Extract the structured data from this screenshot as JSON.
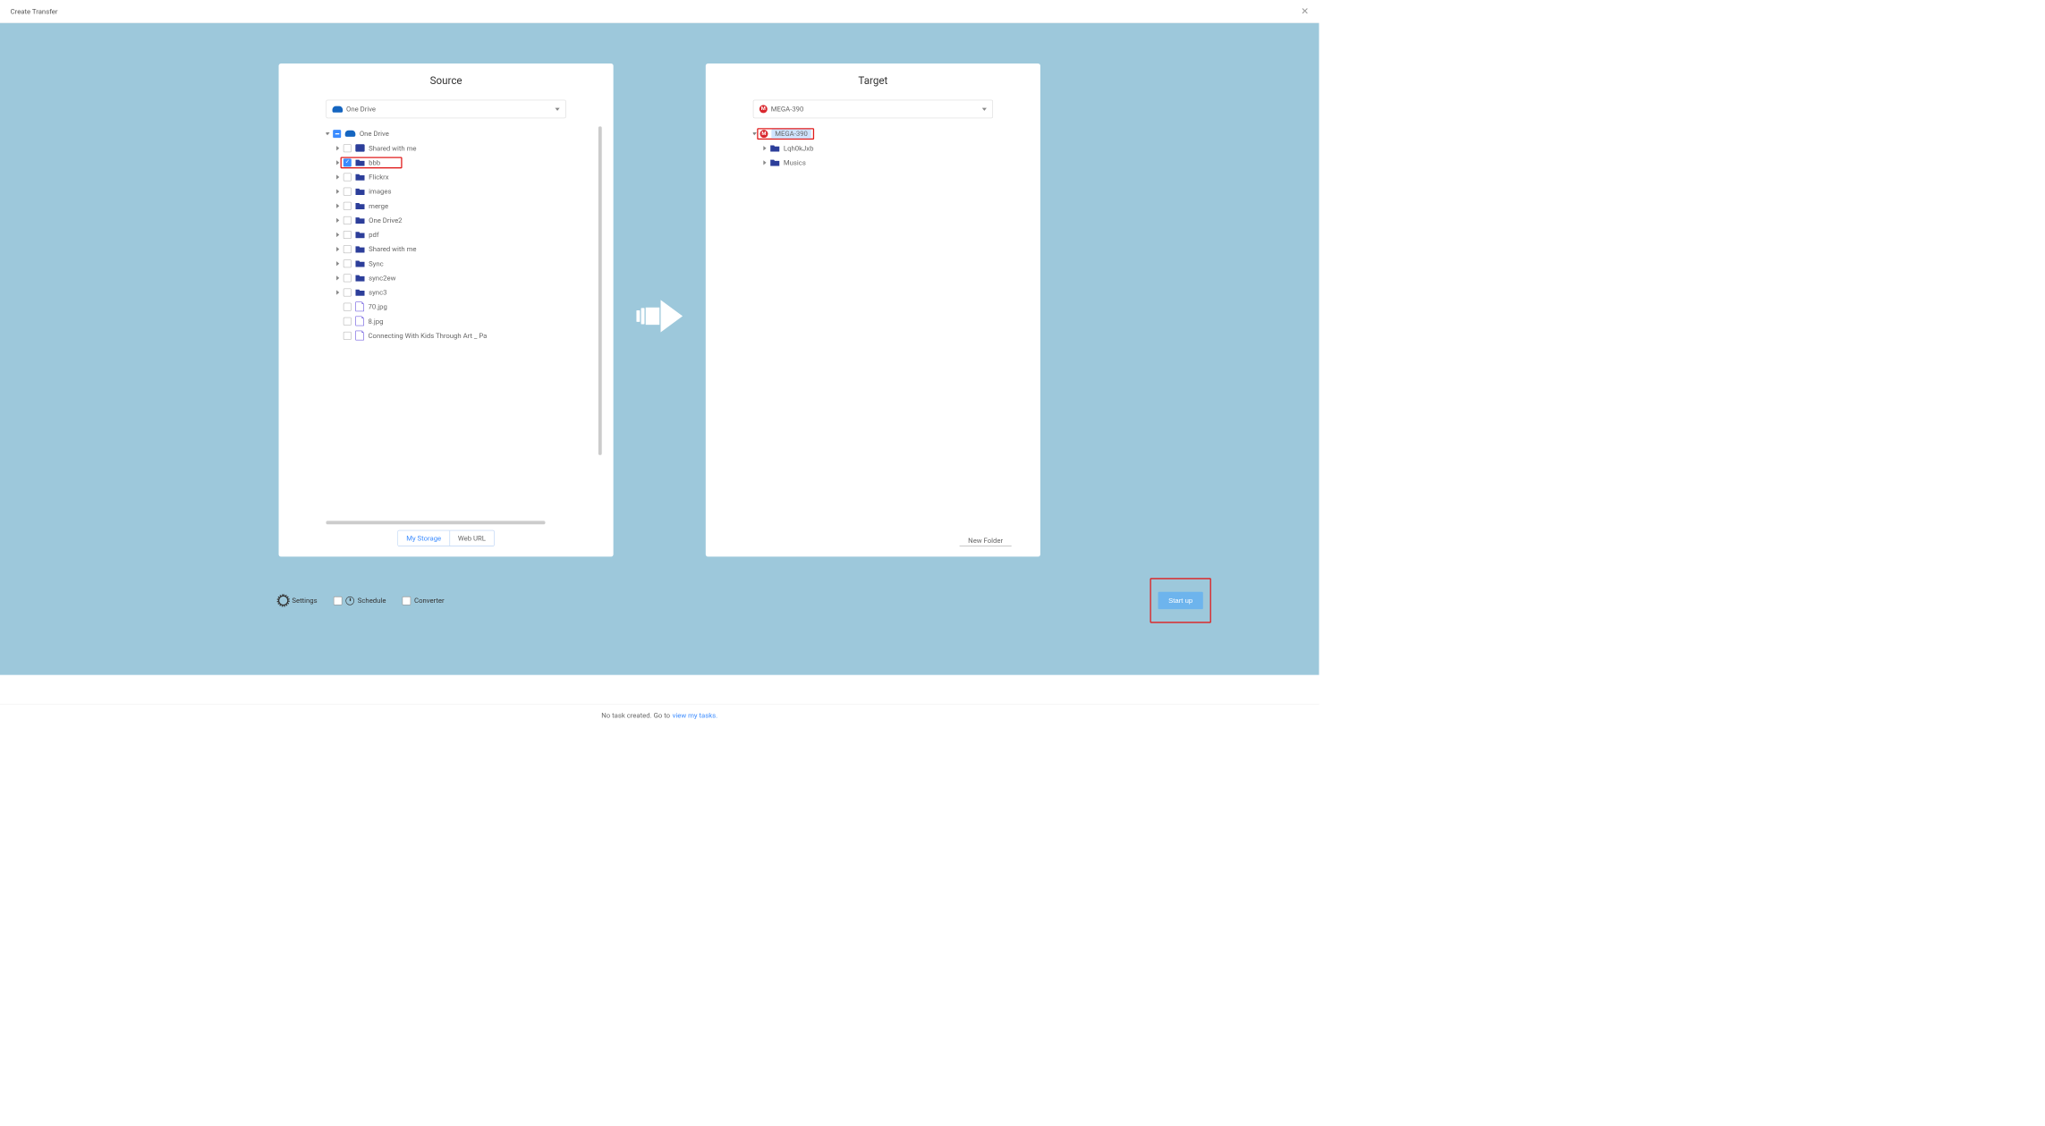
{
  "header": {
    "title": "Create Transfer"
  },
  "source": {
    "title": "Source",
    "selected_cloud": "One Drive",
    "root": "One Drive",
    "folders": [
      {
        "name": "Shared with me",
        "kind": "shared"
      },
      {
        "name": "bbb",
        "kind": "folder",
        "checked": true,
        "hl": true
      },
      {
        "name": "Flickrx",
        "kind": "folder"
      },
      {
        "name": "images",
        "kind": "folder"
      },
      {
        "name": "merge",
        "kind": "folder"
      },
      {
        "name": "One Drive2",
        "kind": "folder"
      },
      {
        "name": "pdf",
        "kind": "folder"
      },
      {
        "name": "Shared with me",
        "kind": "folder"
      },
      {
        "name": "Sync",
        "kind": "folder"
      },
      {
        "name": "sync2ew",
        "kind": "folder"
      },
      {
        "name": "sync3",
        "kind": "folder"
      }
    ],
    "files": [
      {
        "name": "70.jpg"
      },
      {
        "name": "8.jpg"
      },
      {
        "name": "Connecting With Kids Through Art _ Pa"
      }
    ],
    "tabs": {
      "a": "My Storage",
      "b": "Web URL"
    }
  },
  "target": {
    "title": "Target",
    "selected_cloud": "MEGA-390",
    "root": "MEGA-390",
    "folders": [
      {
        "name": "Lqh0kJxb"
      },
      {
        "name": "Musics"
      }
    ],
    "new_folder": "New Folder"
  },
  "options": {
    "settings": "Settings",
    "schedule": "Schedule",
    "converter": "Converter"
  },
  "start": "Start up",
  "status": {
    "pre": "No task created. Go to",
    "link": "view my tasks."
  }
}
